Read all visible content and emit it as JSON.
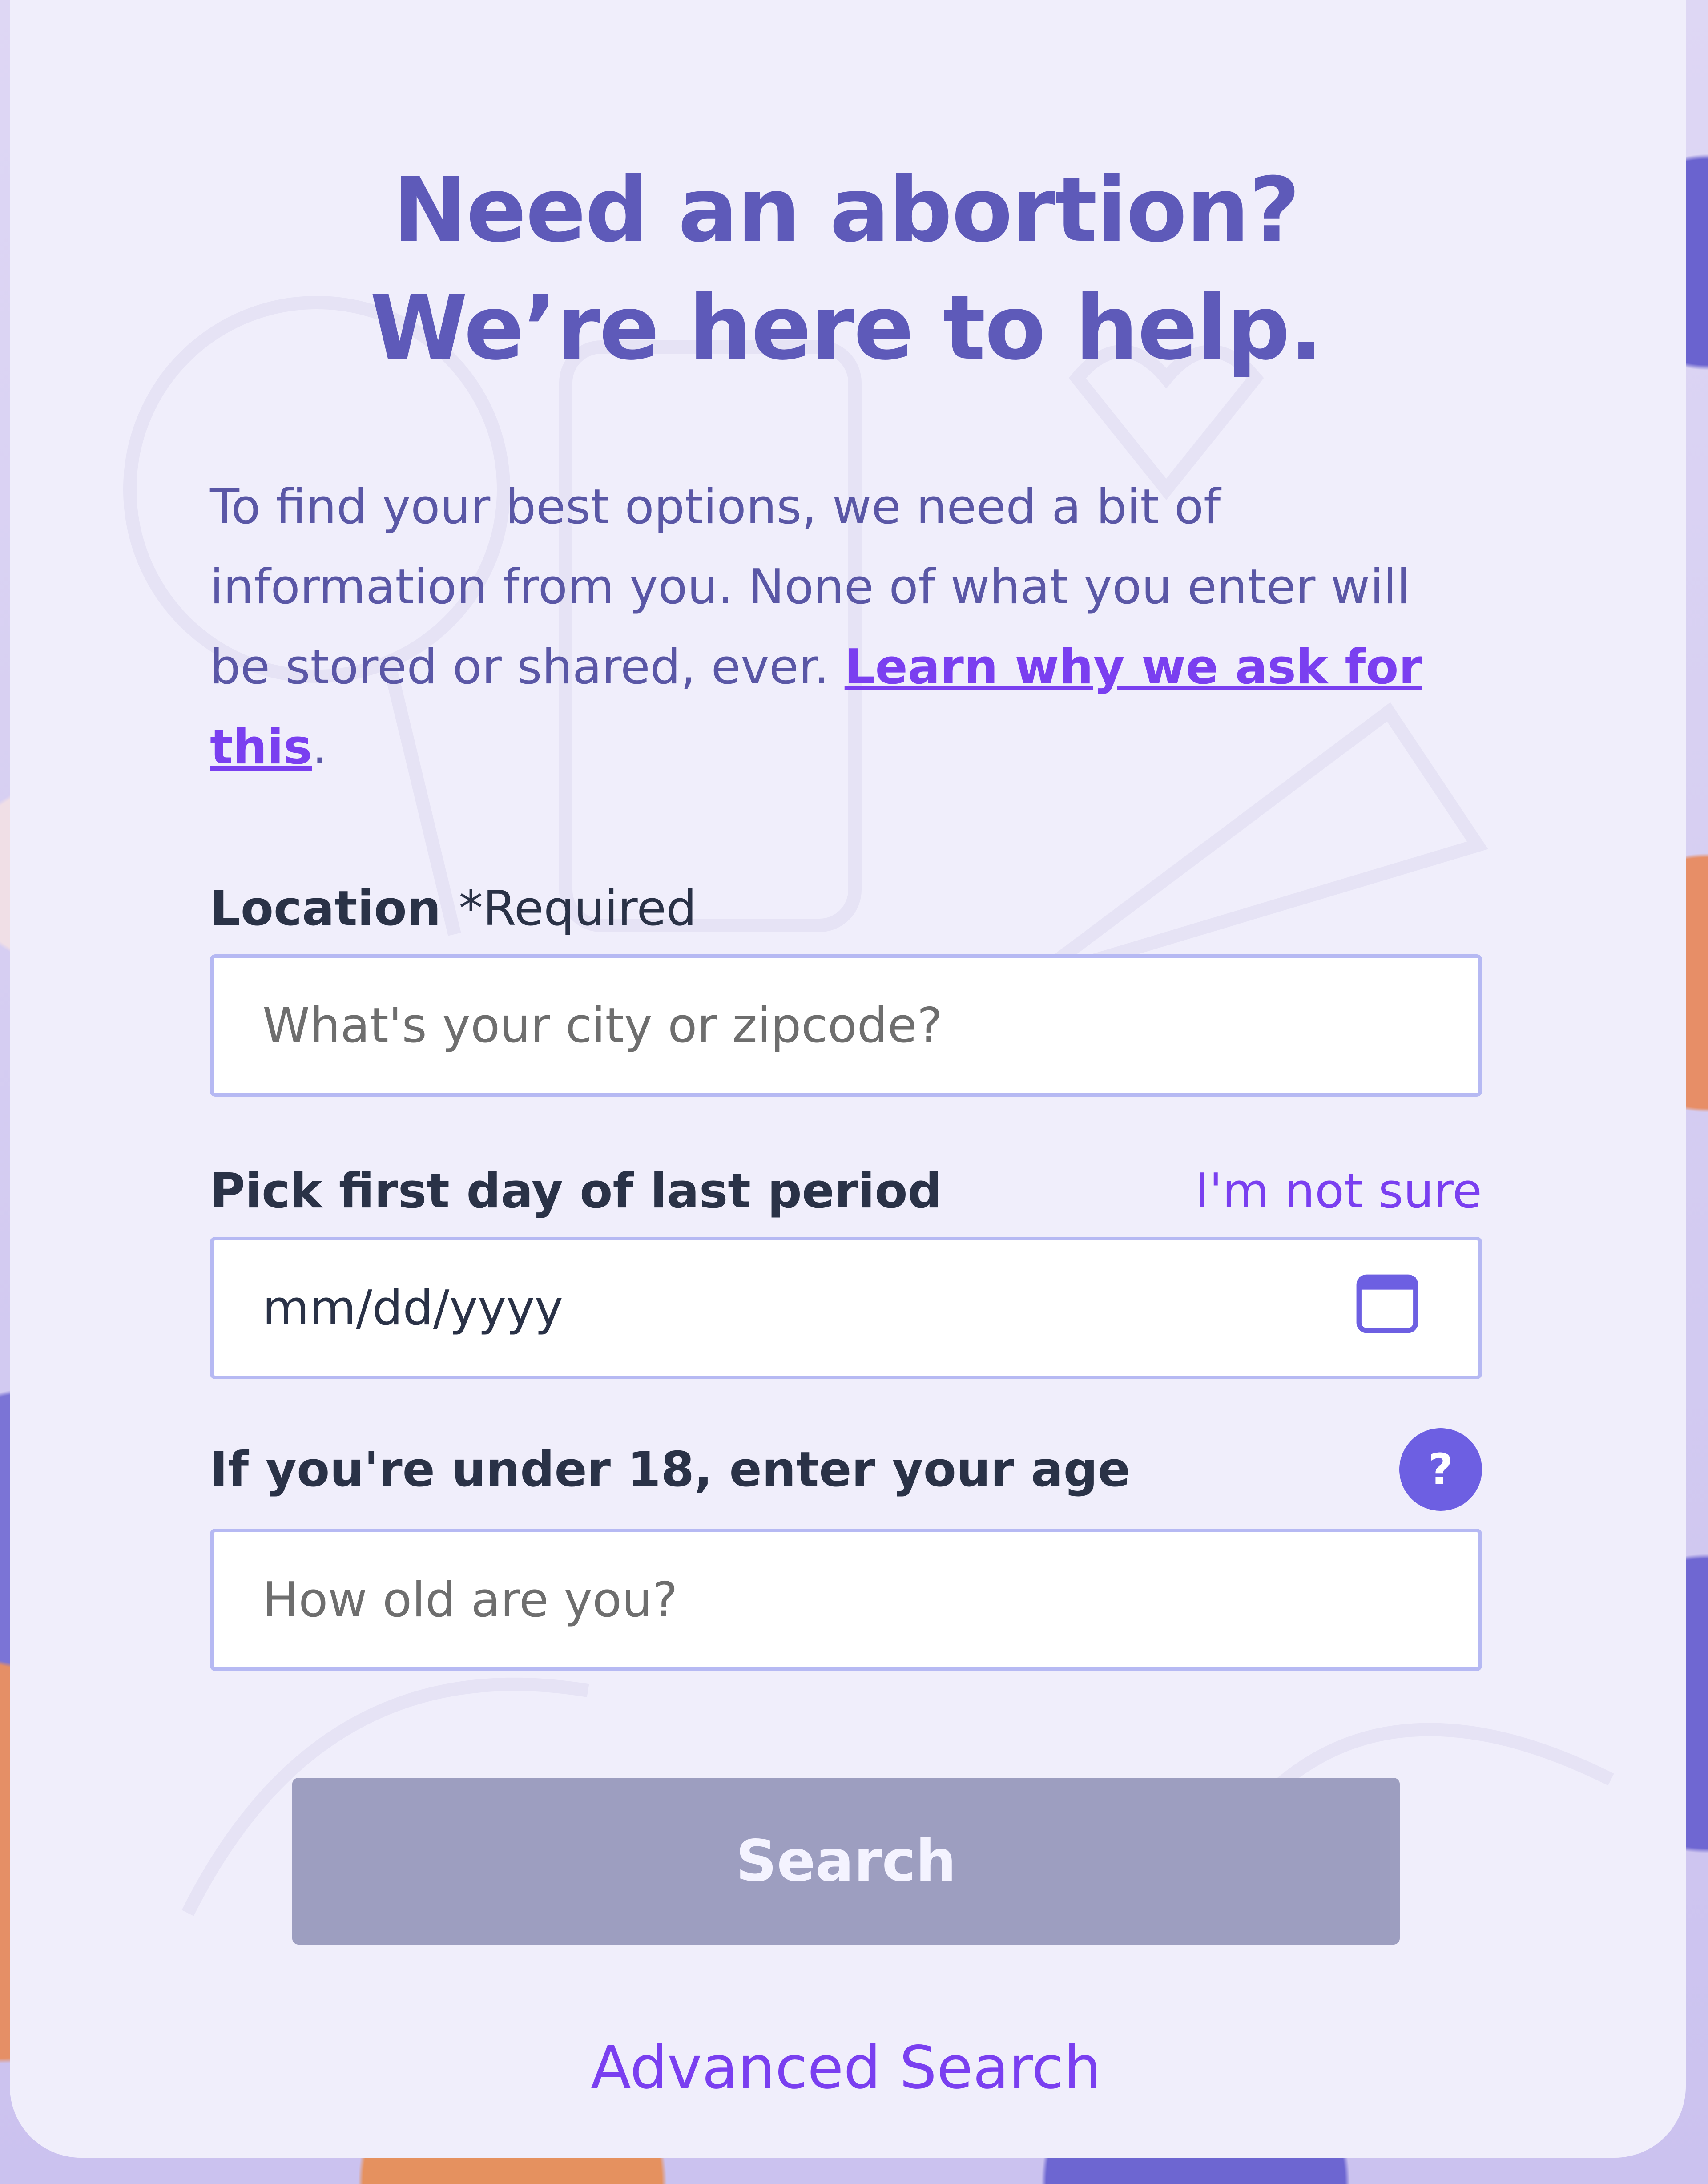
{
  "header": {
    "title_line1": "Need an abortion?",
    "title_line2": "We’re here to help."
  },
  "intro": {
    "text": "To find your best options, we need a bit of information from you. None of what you enter will be stored or shared, ever. ",
    "link_text": "Learn why we ask for this",
    "trailing": "."
  },
  "location": {
    "label": "Location",
    "required": "*Required",
    "placeholder": "What's your city or zipcode?"
  },
  "period": {
    "label": "Pick first day of last period",
    "not_sure_link": "I'm not sure",
    "placeholder": "mm/dd/yyyy",
    "icon": "calendar-icon"
  },
  "age": {
    "label": "If you're under 18, enter your age",
    "help_icon_glyph": "?",
    "help_icon": "help-icon",
    "placeholder": "How old are you?"
  },
  "actions": {
    "search_label": "Search",
    "advanced_label": "Advanced Search"
  },
  "colors": {
    "accent": "#7a3ff0",
    "title": "#5e5ab9",
    "button_disabled": "#9d9ec0",
    "input_border": "#b6b9f3"
  }
}
